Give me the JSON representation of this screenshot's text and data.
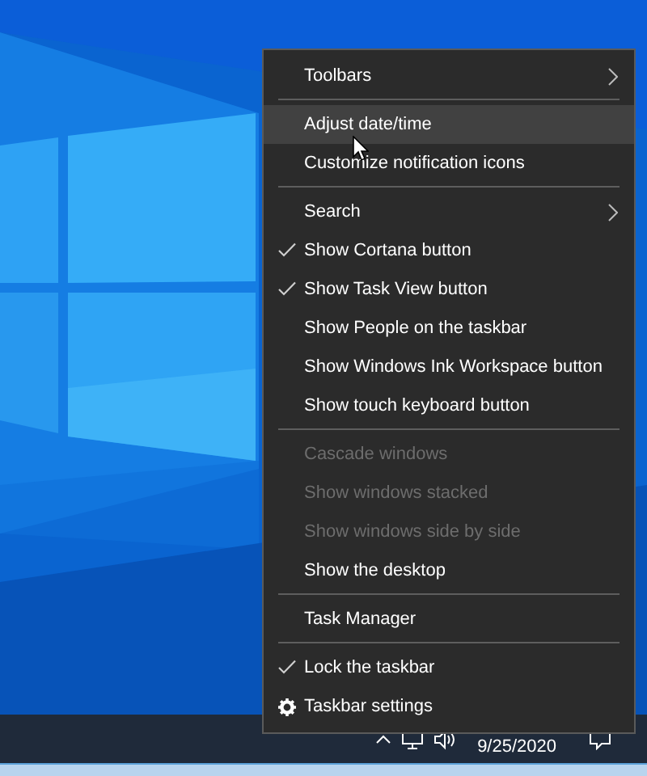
{
  "context_menu": {
    "items": [
      {
        "kind": "item",
        "label": "Toolbars",
        "checked": false,
        "disabled": false,
        "selected": false,
        "submenu": true
      },
      {
        "kind": "separator"
      },
      {
        "kind": "item",
        "label": "Adjust date/time",
        "checked": false,
        "disabled": false,
        "selected": true,
        "submenu": false
      },
      {
        "kind": "item",
        "label": "Customize notification icons",
        "checked": false,
        "disabled": false,
        "selected": false,
        "submenu": false
      },
      {
        "kind": "separator"
      },
      {
        "kind": "item",
        "label": "Search",
        "checked": false,
        "disabled": false,
        "selected": false,
        "submenu": true
      },
      {
        "kind": "item",
        "label": "Show Cortana button",
        "checked": true,
        "disabled": false,
        "selected": false,
        "submenu": false
      },
      {
        "kind": "item",
        "label": "Show Task View button",
        "checked": true,
        "disabled": false,
        "selected": false,
        "submenu": false
      },
      {
        "kind": "item",
        "label": "Show People on the taskbar",
        "checked": false,
        "disabled": false,
        "selected": false,
        "submenu": false
      },
      {
        "kind": "item",
        "label": "Show Windows Ink Workspace button",
        "checked": false,
        "disabled": false,
        "selected": false,
        "submenu": false
      },
      {
        "kind": "item",
        "label": "Show touch keyboard button",
        "checked": false,
        "disabled": false,
        "selected": false,
        "submenu": false
      },
      {
        "kind": "separator"
      },
      {
        "kind": "item",
        "label": "Cascade windows",
        "checked": false,
        "disabled": true,
        "selected": false,
        "submenu": false
      },
      {
        "kind": "item",
        "label": "Show windows stacked",
        "checked": false,
        "disabled": true,
        "selected": false,
        "submenu": false
      },
      {
        "kind": "item",
        "label": "Show windows side by side",
        "checked": false,
        "disabled": true,
        "selected": false,
        "submenu": false
      },
      {
        "kind": "item",
        "label": "Show the desktop",
        "checked": false,
        "disabled": false,
        "selected": false,
        "submenu": false
      },
      {
        "kind": "separator"
      },
      {
        "kind": "item",
        "label": "Task Manager",
        "checked": false,
        "disabled": false,
        "selected": false,
        "submenu": false
      },
      {
        "kind": "separator"
      },
      {
        "kind": "item",
        "label": "Lock the taskbar",
        "checked": true,
        "disabled": false,
        "selected": false,
        "submenu": false
      },
      {
        "kind": "settings",
        "label": "Taskbar settings",
        "checked": false,
        "disabled": false,
        "selected": false,
        "submenu": false
      }
    ]
  },
  "taskbar": {
    "date": "9/25/2020"
  }
}
